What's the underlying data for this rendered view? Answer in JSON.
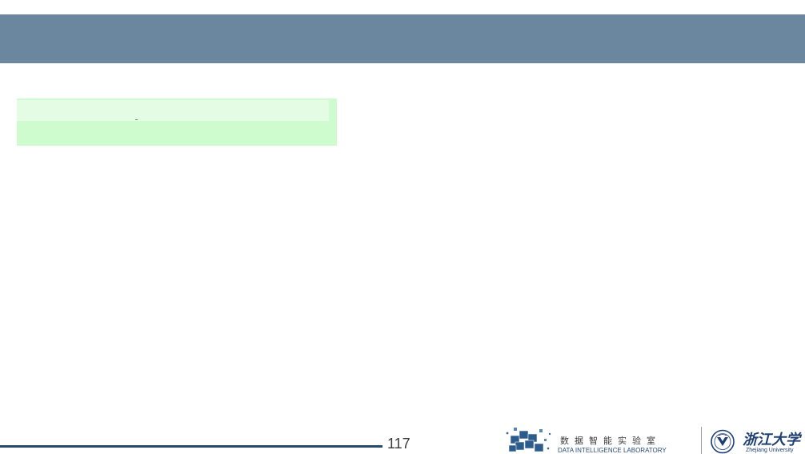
{
  "header": {
    "title": "",
    "bar_color": "#6a879f"
  },
  "content": {
    "highlight_box_color": "#cffccf"
  },
  "footer": {
    "page_number": "117",
    "line_color": "#244a6e",
    "lab": {
      "logo_icon": "cube-cluster-logo",
      "name_cn": "数据智能实验室",
      "name_en": "DATA INTELLIGENCE LABORATORY"
    },
    "university": {
      "seal_icon": "university-seal",
      "name_cn": "浙江大学",
      "name_en": "Zhejiang University"
    }
  }
}
